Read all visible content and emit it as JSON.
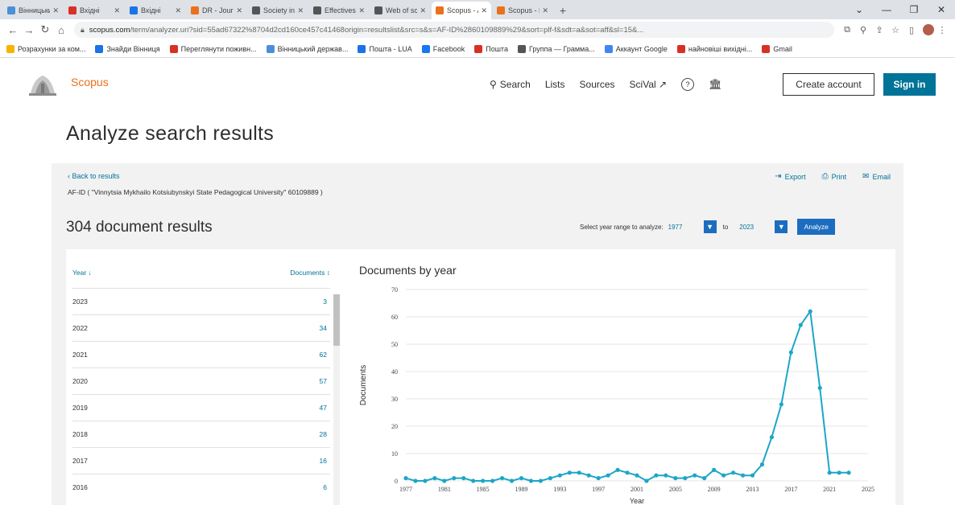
{
  "browser": {
    "tabs": [
      {
        "title": "Вінницький",
        "color": "#4a90d9",
        "active": false
      },
      {
        "title": "Вхідні",
        "color": "#d93025",
        "active": false
      },
      {
        "title": "Вхідні",
        "color": "#1a73e8",
        "active": false
      },
      {
        "title": "DR - Journ",
        "color": "#e9711c",
        "active": false
      },
      {
        "title": "Society in",
        "color": "#555555",
        "active": false
      },
      {
        "title": "Effectives",
        "color": "#555555",
        "active": false
      },
      {
        "title": "Web of sci",
        "color": "#555555",
        "active": false
      },
      {
        "title": "Scopus - A",
        "color": "#e9711c",
        "active": true
      },
      {
        "title": "Scopus - D",
        "color": "#e9711c",
        "active": false
      }
    ],
    "url_domain": "scopus.com",
    "url_path": "/term/analyzer.uri?sid=55ad67322%8704d2cd160ce457c41468origin=resultslist&src=s&s=AF-ID%2860109889%29&sort=plf-f&sdt=a&sot=aff&sl=15&...",
    "bookmarks": [
      {
        "label": "Розрахунки за ком...",
        "color": "#f4b400"
      },
      {
        "label": "Знайди Вінниця",
        "color": "#1a73e8"
      },
      {
        "label": "Переглянути поживн...",
        "color": "#d93025"
      },
      {
        "label": "Вінницький держав...",
        "color": "#4a90d9"
      },
      {
        "label": "Пошта - LUA",
        "color": "#1a73e8"
      },
      {
        "label": "Facebook",
        "color": "#1877f2"
      },
      {
        "label": "Пошта",
        "color": "#d93025"
      },
      {
        "label": "Группа — Грамма...",
        "color": "#555555"
      },
      {
        "label": "Аккаунт Google",
        "color": "#4285f4"
      },
      {
        "label": "найновіші вихідні...",
        "color": "#d93025"
      },
      {
        "label": "Gmail",
        "color": "#d93025"
      }
    ]
  },
  "header": {
    "brand": "Scopus",
    "nav": {
      "search": "Search",
      "lists": "Lists",
      "sources": "Sources",
      "scival": "SciVal ↗"
    },
    "create_account": "Create account",
    "sign_in": "Sign in"
  },
  "page": {
    "title": "Analyze search results",
    "back_link": "‹ Back to results",
    "query": "AF-ID ( \"Vinnytsia Mykhailo Kotsiubynskyi State Pedagogical University\"  60109889 )",
    "actions": {
      "export": "Export",
      "print": "Print",
      "email": "Email"
    },
    "results_count": "304 document results",
    "year_range": {
      "label": "Select year range to analyze:",
      "from": "1977",
      "to_label": "to",
      "to": "2023",
      "analyze": "Analyze"
    }
  },
  "year_table": {
    "year_header": "Year ↓",
    "docs_header": "Documents ↕",
    "rows": [
      {
        "year": "2023",
        "docs": "3"
      },
      {
        "year": "2022",
        "docs": "34"
      },
      {
        "year": "2021",
        "docs": "62"
      },
      {
        "year": "2020",
        "docs": "57"
      },
      {
        "year": "2019",
        "docs": "47"
      },
      {
        "year": "2018",
        "docs": "28"
      },
      {
        "year": "2017",
        "docs": "16"
      },
      {
        "year": "2016",
        "docs": "6"
      }
    ]
  },
  "chart_data": {
    "type": "line",
    "title": "Documents by year",
    "xlabel": "Year",
    "ylabel": "Documents",
    "xlim": [
      1977,
      2025
    ],
    "ylim": [
      0,
      70
    ],
    "xticks": [
      1977,
      1981,
      1985,
      1989,
      1993,
      1997,
      2001,
      2005,
      2009,
      2013,
      2017,
      2021,
      2025
    ],
    "yticks": [
      0,
      10,
      20,
      30,
      40,
      50,
      60,
      70
    ],
    "grid": true,
    "color": "#1da6c7",
    "x": [
      1977,
      1978,
      1979,
      1980,
      1981,
      1982,
      1983,
      1984,
      1985,
      1986,
      1987,
      1988,
      1989,
      1990,
      1991,
      1992,
      1993,
      1994,
      1995,
      1996,
      1997,
      1998,
      1999,
      2000,
      2001,
      2002,
      2003,
      2004,
      2005,
      2006,
      2007,
      2008,
      2009,
      2010,
      2011,
      2012,
      2013,
      2014,
      2015,
      2016,
      2017,
      2018,
      2019,
      2020,
      2021,
      2022,
      2023
    ],
    "y": [
      1,
      0,
      0,
      1,
      0,
      1,
      1,
      0,
      0,
      0,
      1,
      0,
      1,
      0,
      0,
      1,
      2,
      3,
      3,
      2,
      1,
      2,
      4,
      3,
      2,
      0,
      2,
      2,
      1,
      1,
      2,
      1,
      4,
      2,
      3,
      2,
      2,
      6,
      16,
      28,
      47,
      57,
      62,
      34,
      3,
      3,
      3
    ]
  }
}
